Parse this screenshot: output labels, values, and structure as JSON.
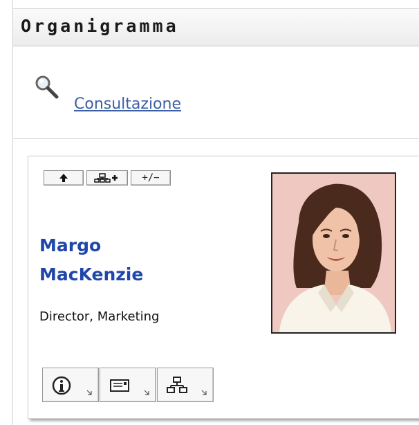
{
  "portlet": {
    "title": "Organigramma"
  },
  "lookup": {
    "link_label": "Consultazione"
  },
  "person": {
    "first_name": "Margo",
    "last_name": "MacKenzie",
    "job_title": "Director, Marketing"
  },
  "nav_buttons": {
    "up_icon": "arrow-up-icon",
    "expand_icon": "org-expand-icon",
    "toggle_label": "+/−"
  },
  "action_buttons": [
    {
      "icon": "info-icon"
    },
    {
      "icon": "email-icon"
    },
    {
      "icon": "org-chart-icon"
    }
  ],
  "colors": {
    "link": "#3d5fa6",
    "name": "#1f46a8"
  }
}
